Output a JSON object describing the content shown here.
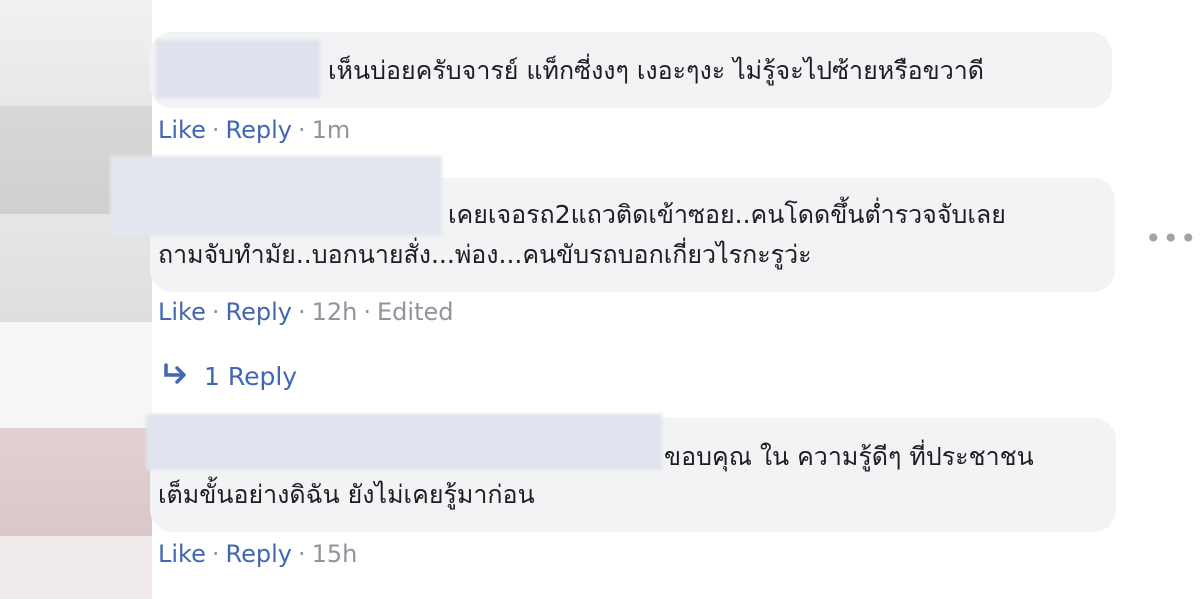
{
  "comments": [
    {
      "text_lines": [
        "เห็นบ่อยครับจารย์ แท็กซี่งงๆ เงอะๆงะ ไม่รู้จะไปซ้ายหรือขวาดี"
      ],
      "actions": {
        "like": "Like",
        "reply": "Reply",
        "time": "1m"
      }
    },
    {
      "text_lines": [
        "เคยเจอรถ2แถวติดเข้าซอย..คนโดดขึ้นต่ำรวจจับเลย",
        "ถามจับทำมัย..บอกนายสั่ง...พ่อง...คนขับรถบอกเกี่ยวไรกะรูว่ะ"
      ],
      "actions": {
        "like": "Like",
        "reply": "Reply",
        "time": "12h",
        "edited": "Edited"
      },
      "replies_link": "1 Reply"
    },
    {
      "text_lines": [
        "ขอบคุณ ใน ความรู้ดีๆ ที่ประชาชน",
        "เต็มขั้นอย่างดิฉัน ยังไม่เคยรู้มาก่อน"
      ],
      "actions": {
        "like": "Like",
        "reply": "Reply",
        "time": "15h"
      }
    }
  ],
  "icons": {
    "more": "more-options-icon",
    "reply_arrow": "reply-arrow-icon"
  },
  "colors": {
    "link": "#4267b2",
    "bubble": "#f2f3f5",
    "meta": "#90949c"
  }
}
